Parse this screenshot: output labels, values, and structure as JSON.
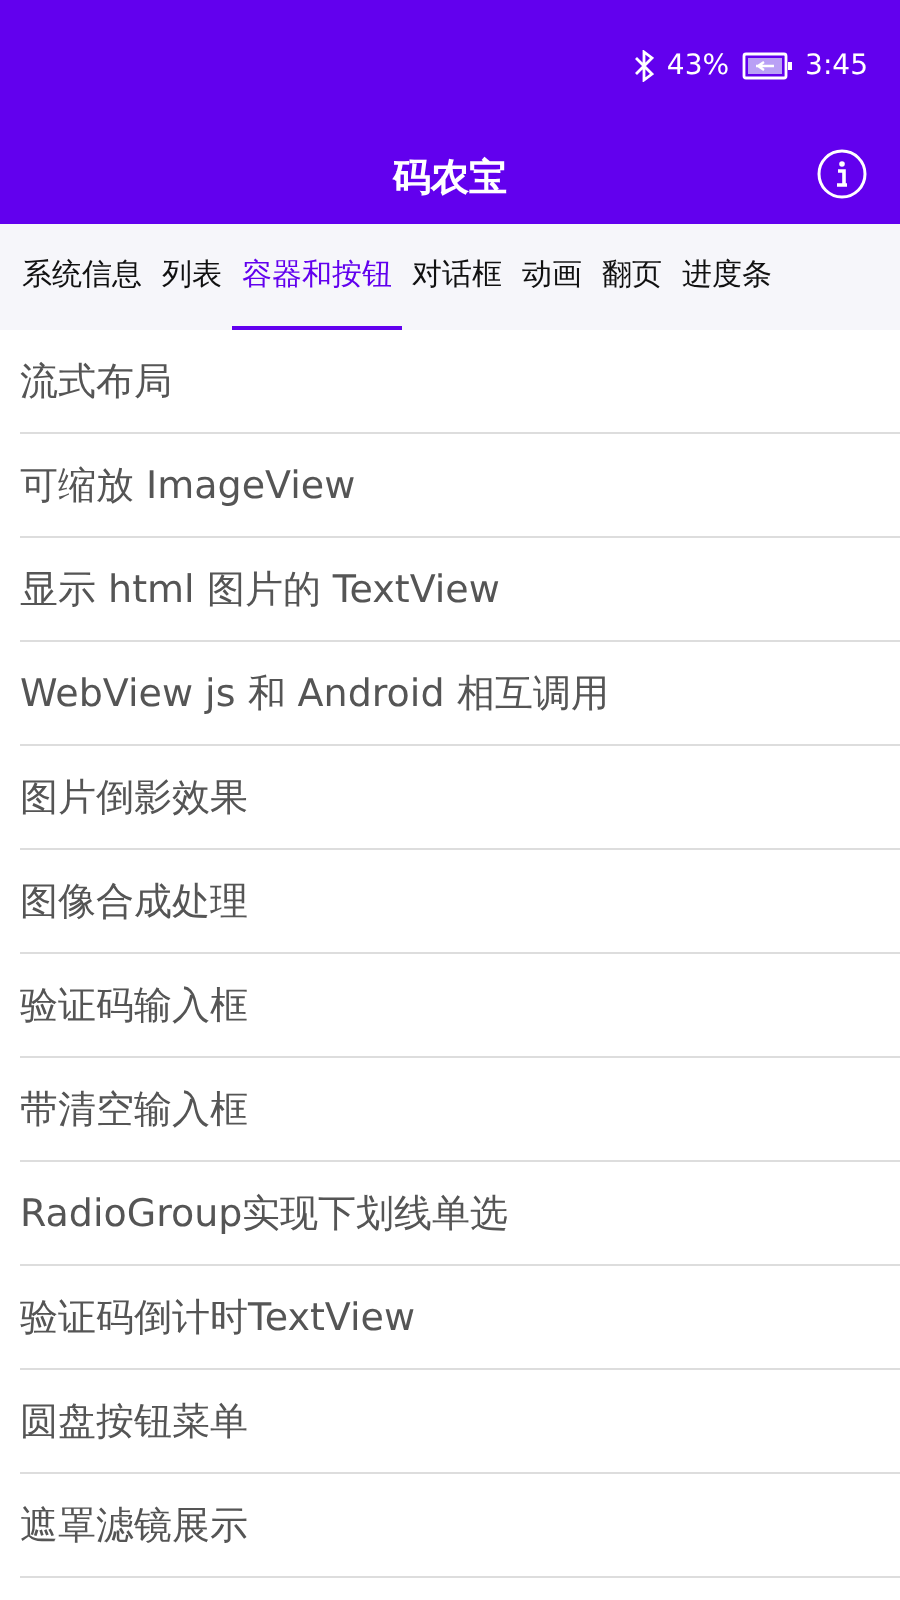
{
  "status_bar": {
    "battery": "43%",
    "time": "3:45"
  },
  "app_bar": {
    "title": "码农宝"
  },
  "tabs": [
    {
      "label": "系统信息",
      "selected": false
    },
    {
      "label": "列表",
      "selected": false
    },
    {
      "label": "容器和按钮",
      "selected": true
    },
    {
      "label": "对话框",
      "selected": false
    },
    {
      "label": "动画",
      "selected": false
    },
    {
      "label": "翻页",
      "selected": false
    },
    {
      "label": "进度条",
      "selected": false
    }
  ],
  "items": [
    "流式布局",
    "可缩放 ImageView",
    "显示 html 图片的 TextView",
    "WebView js 和 Android 相互调用",
    "图片倒影效果",
    "图像合成处理",
    "验证码输入框",
    "带清空输入框",
    "RadioGroup实现下划线单选",
    "验证码倒计时TextView",
    "圆盘按钮菜单",
    "遮罩滤镜展示"
  ]
}
